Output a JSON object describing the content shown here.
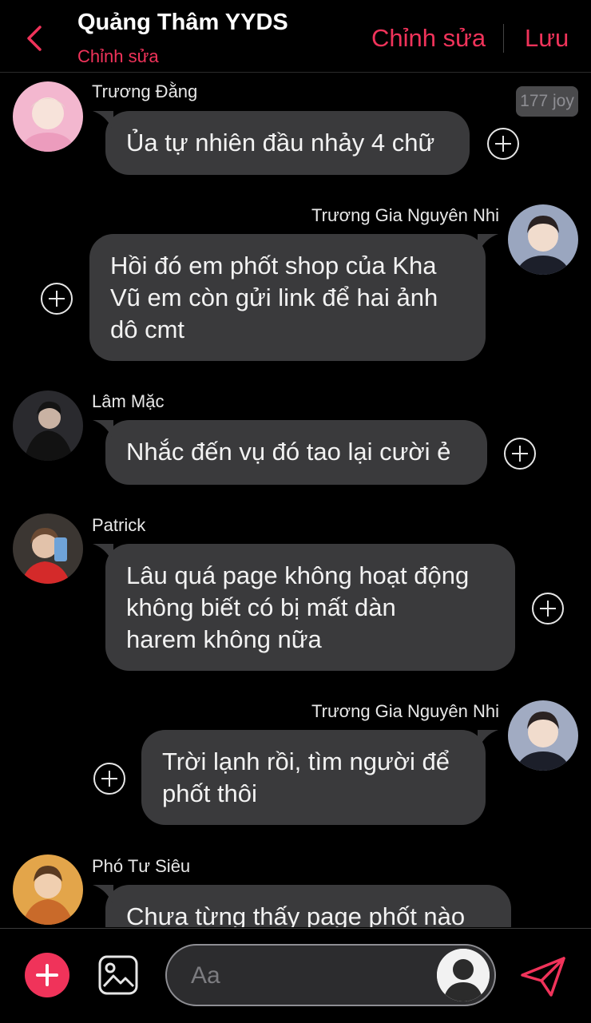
{
  "header": {
    "title": "Quảng Thâm YYDS",
    "subtitle": "Chỉnh sửa",
    "edit_label": "Chỉnh sửa",
    "save_label": "Lưu"
  },
  "joy_badge": "177 joy",
  "messages": [
    {
      "sender": "Trương Đằng",
      "side": "left",
      "lines": [
        "Ủa tự nhiên đầu nhảy 4 chữ"
      ]
    },
    {
      "sender": "Trương Gia Nguyên Nhi",
      "side": "right",
      "lines": [
        "Hồi đó em phốt shop của Kha",
        "Vũ em còn gửi link để hai ảnh",
        "dô cmt"
      ]
    },
    {
      "sender": "Lâm Mặc",
      "side": "left",
      "lines": [
        "Nhắc đến vụ đó tao lại cười ẻ"
      ]
    },
    {
      "sender": "Patrick",
      "side": "left",
      "lines": [
        "Lâu quá page không hoạt động",
        "không biết có bị mất dàn",
        "harem không nữa"
      ]
    },
    {
      "sender": "Trương Gia Nguyên Nhi",
      "side": "right",
      "lines": [
        "Trời lạnh rồi, tìm người để",
        "phốt thôi"
      ]
    },
    {
      "sender": "Phó Tư Siêu",
      "side": "left",
      "lines": [
        "Chưa từng thấy page phốt nào"
      ]
    }
  ],
  "composer": {
    "placeholder": "Aa"
  },
  "colors": {
    "accent": "#f0335a",
    "bubble": "#3a3a3c",
    "background": "#000000"
  }
}
